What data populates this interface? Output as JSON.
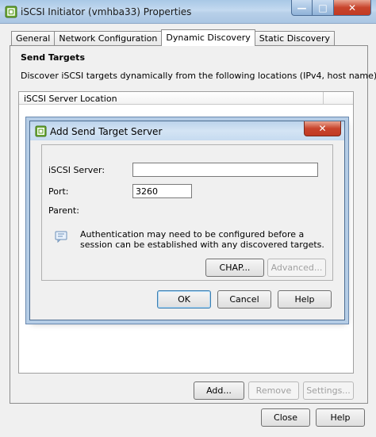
{
  "window": {
    "title": "iSCSI Initiator (vmhba33) Properties",
    "caption_min": "—",
    "caption_max": "□",
    "caption_close": "✕"
  },
  "tabs": [
    {
      "label": "General"
    },
    {
      "label": "Network Configuration"
    },
    {
      "label": "Dynamic Discovery"
    },
    {
      "label": "Static Discovery"
    }
  ],
  "send_targets": {
    "title": "Send Targets",
    "description": "Discover iSCSI targets dynamically from the following locations (IPv4, host name):",
    "column_header": "iSCSI Server Location"
  },
  "list_buttons": {
    "add": "Add...",
    "remove": "Remove",
    "settings": "Settings..."
  },
  "footer_buttons": {
    "close": "Close",
    "help": "Help"
  },
  "dialog": {
    "title": "Add Send Target Server",
    "close": "✕",
    "server_label": "iSCSI Server:",
    "server_value": "",
    "port_label": "Port:",
    "port_value": "3260",
    "parent_label": "Parent:",
    "note": "Authentication may need to be configured before a session can be established with any discovered targets.",
    "chap": "CHAP...",
    "advanced": "Advanced...",
    "ok": "OK",
    "cancel": "Cancel",
    "help": "Help"
  }
}
